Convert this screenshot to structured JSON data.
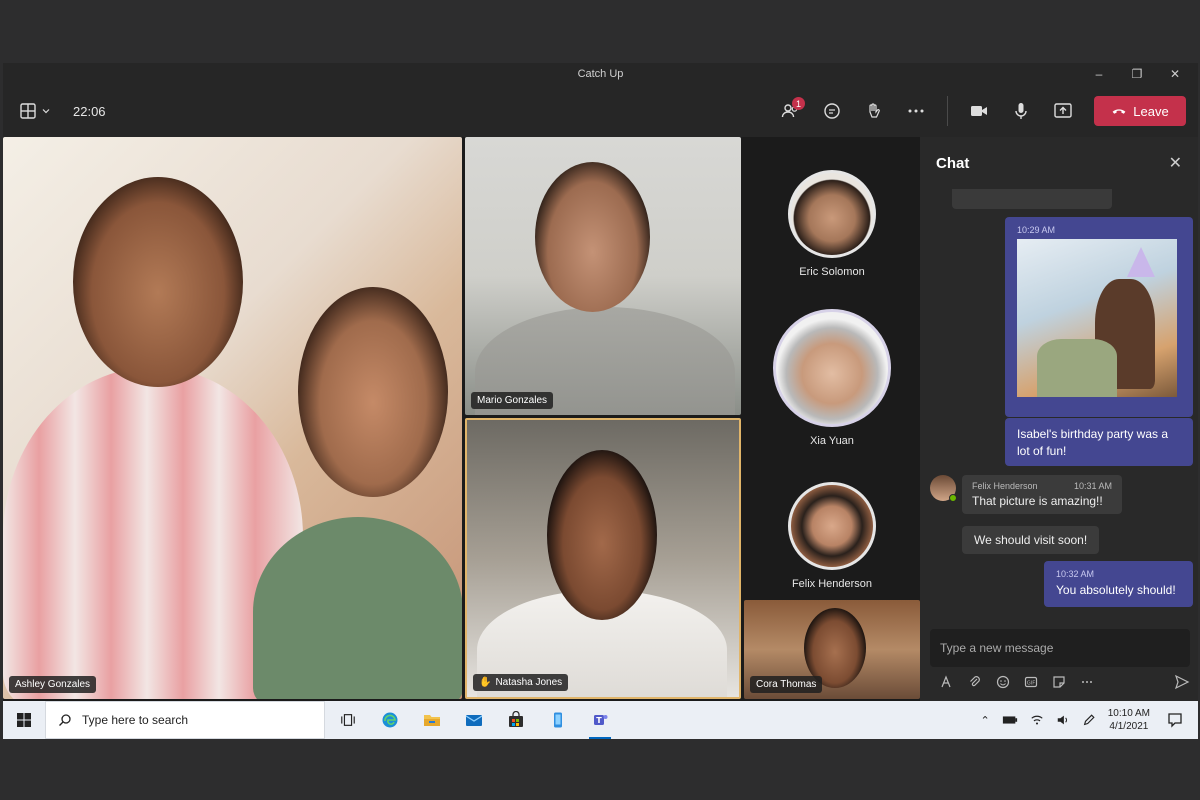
{
  "window": {
    "title": "Catch Up",
    "controls": {
      "minimize": "–",
      "restore": "❐",
      "close": "✕"
    }
  },
  "toolbar": {
    "elapsed_time": "22:06",
    "participants_badge": "1",
    "leave_label": "Leave",
    "icons": [
      "grid-layout-icon",
      "chevron-down-icon",
      "people-icon",
      "chat-bubble-icon",
      "raise-hand-icon",
      "more-icon",
      "camera-icon",
      "microphone-icon",
      "share-screen-icon",
      "phone-hangup-icon"
    ],
    "leave_color": "#c4314b"
  },
  "stage": {
    "tiles": [
      {
        "name": "Ashley Gonzales"
      },
      {
        "name": "Mario Gonzales"
      },
      {
        "name": "Natasha Jones",
        "hand_raised": true
      },
      {
        "name": "Cora Thomas"
      }
    ],
    "roster": [
      {
        "name": "Eric Solomon"
      },
      {
        "name": "Xia Yuan"
      },
      {
        "name": "Felix Henderson"
      }
    ],
    "active_speaker_color": "#e1b56a"
  },
  "chat": {
    "title": "Chat",
    "messages": [
      {
        "type": "image",
        "time": "10:29 AM"
      },
      {
        "type": "text",
        "text": "Isabel's birthday party was a lot of fun!"
      },
      {
        "type": "other",
        "sender": "Felix Henderson",
        "time": "10:31 AM",
        "text": "That picture is amazing!!"
      },
      {
        "type": "other-continued",
        "text": "We should visit soon!"
      },
      {
        "type": "text",
        "time": "10:32 AM",
        "text": "You absolutely should!"
      }
    ],
    "compose_placeholder": "Type a new message",
    "bubble_color": "#444791"
  },
  "taskbar": {
    "search_placeholder": "Type here to search",
    "time": "10:10 AM",
    "date": "4/1/2021",
    "apps": [
      "task-view-icon",
      "edge-icon",
      "file-explorer-icon",
      "mail-icon",
      "store-icon",
      "phone-link-icon",
      "teams-icon"
    ],
    "active_app": "teams-icon"
  }
}
